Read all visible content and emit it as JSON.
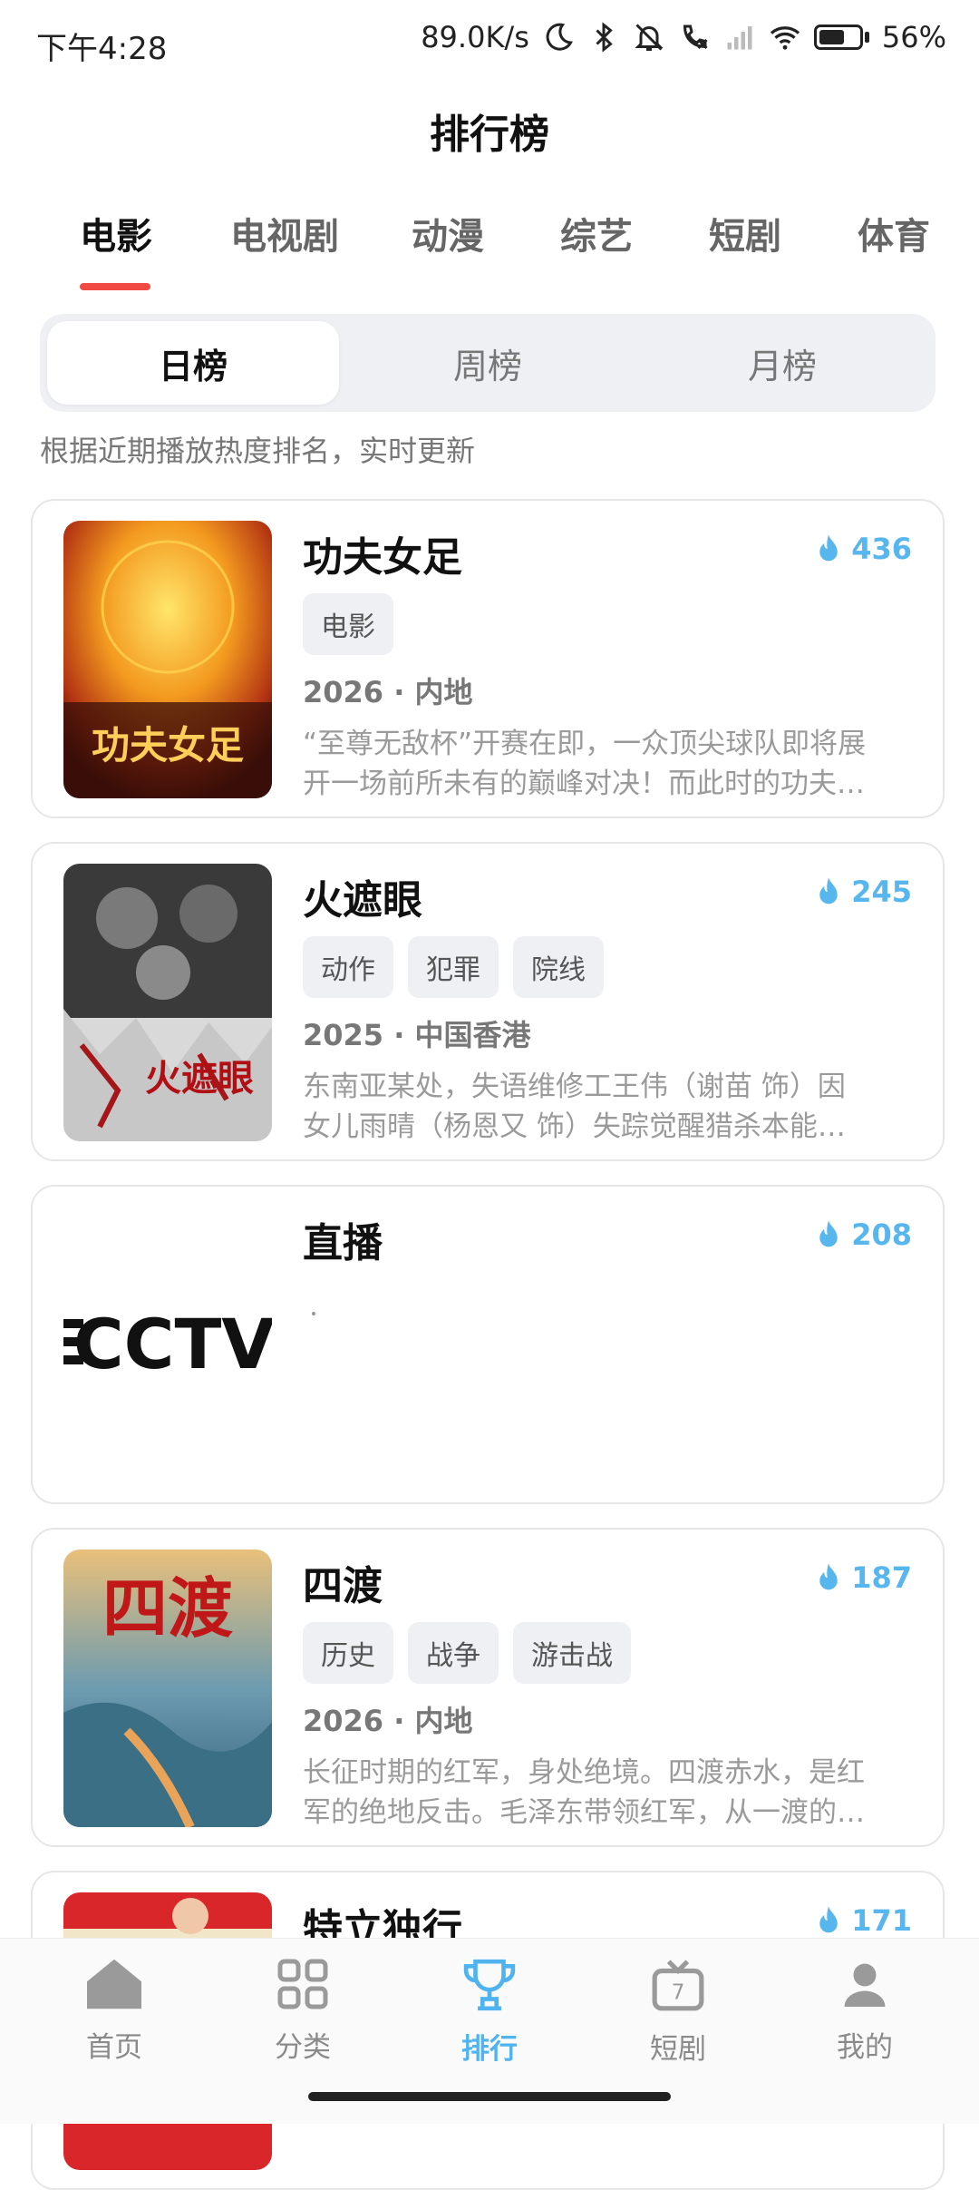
{
  "status_bar": {
    "time": "下午4:28",
    "net_speed": "89.0K/s",
    "battery": "56%",
    "battery_level": 0.56
  },
  "header": {
    "title": "排行榜"
  },
  "category_tabs": [
    {
      "label": "电影",
      "active": true
    },
    {
      "label": "电视剧"
    },
    {
      "label": "动漫"
    },
    {
      "label": "综艺"
    },
    {
      "label": "短剧"
    },
    {
      "label": "体育"
    }
  ],
  "period_tabs": [
    {
      "label": "日榜",
      "active": true
    },
    {
      "label": "周榜"
    },
    {
      "label": "月榜"
    }
  ],
  "subtitle": "根据近期播放热度排名，实时更新",
  "cards": [
    {
      "title": "功夫女足",
      "hot": "436",
      "tags": [
        "电影"
      ],
      "meta": "2026 · 内地",
      "desc_lines": [
        "“至尊无敌杯”开赛在即，一众顶尖球队即将展",
        "开一场前所未有的巅峰对决！而此时的功夫…"
      ],
      "poster_text": "功夫女足"
    },
    {
      "title": "火遮眼",
      "hot": "245",
      "tags": [
        "动作",
        "犯罪",
        "院线"
      ],
      "meta": "2025 · 中国香港",
      "desc_lines": [
        "东南亚某处，失语维修工王伟（谢苗 饰）因",
        "女儿雨晴（杨恩又 饰）失踪觉醒猎杀本能…"
      ],
      "poster_text": "火遮眼"
    },
    {
      "title": "直播",
      "hot": "208",
      "tags": [],
      "meta": "",
      "desc_lines": [],
      "poster_text": "CCTV"
    },
    {
      "title": "四渡",
      "hot": "187",
      "tags": [
        "历史",
        "战争",
        "游击战"
      ],
      "meta": "2026 · 内地",
      "desc_lines": [
        "长征时期的红军，身处绝境。四渡赤水，是红",
        "军的绝地反击。毛泽东带领红军，从一渡的…"
      ],
      "poster_text": "四渡"
    },
    {
      "title": "特立独行",
      "hot": "171",
      "tags": [],
      "meta": "",
      "desc_lines": [],
      "poster_text": ""
    }
  ],
  "bottom_nav": [
    {
      "label": "首页",
      "icon": "home-icon"
    },
    {
      "label": "分类",
      "icon": "grid-icon"
    },
    {
      "label": "排行",
      "icon": "trophy-icon",
      "active": true
    },
    {
      "label": "短剧",
      "icon": "tv-icon"
    },
    {
      "label": "我的",
      "icon": "user-icon"
    }
  ],
  "colors": {
    "accent_red": "#f04a42",
    "accent_blue": "#4fb3ef"
  }
}
